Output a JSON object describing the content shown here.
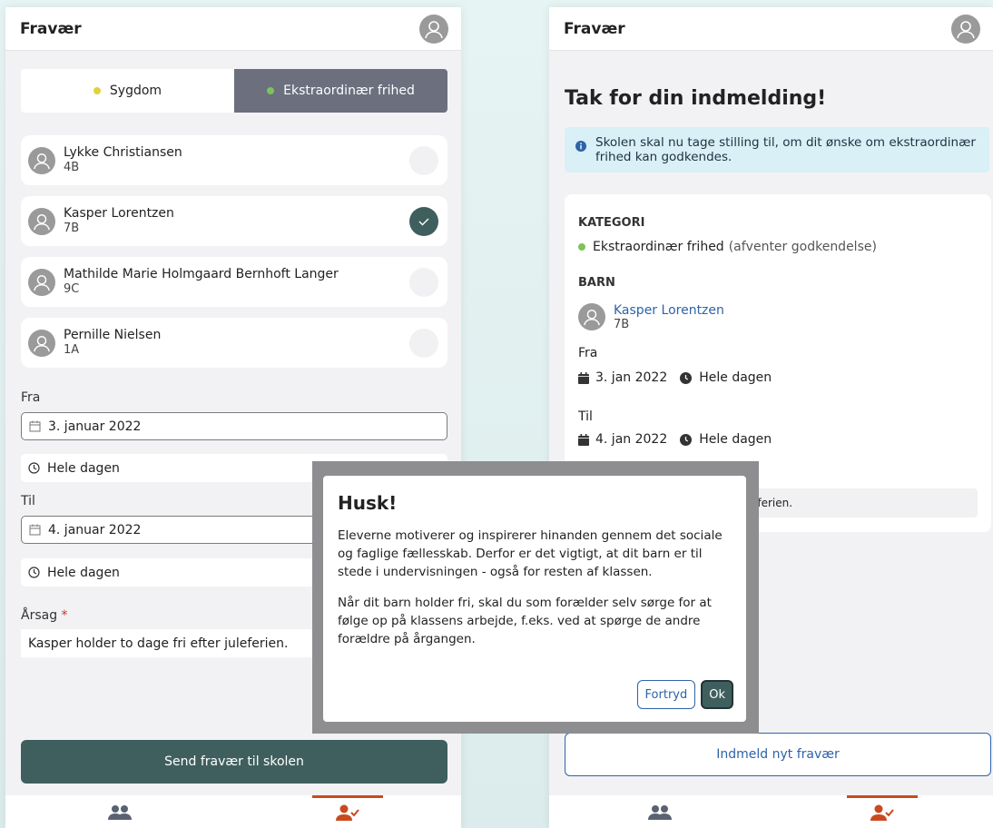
{
  "app_title": "Fravær",
  "left": {
    "tabs": [
      {
        "label": "Sygdom",
        "dot_color": "#e2d23a",
        "active": false
      },
      {
        "label": "Ekstraordinær frihed",
        "dot_color": "#7cc35a",
        "active": true
      }
    ],
    "children": [
      {
        "name": "Lykke Christiansen",
        "class": "4B",
        "selected": false
      },
      {
        "name": "Kasper Lorentzen",
        "class": "7B",
        "selected": true
      },
      {
        "name": "Mathilde Marie Holmgaard Bernhoft Langer",
        "class": "9C",
        "selected": false
      },
      {
        "name": "Pernille Nielsen",
        "class": "1A",
        "selected": false
      }
    ],
    "from_label": "Fra",
    "from_date": "3. januar 2022",
    "from_time": "Hele dagen",
    "to_label": "Til",
    "to_date": "4. januar 2022",
    "to_time": "Hele dagen",
    "reason_label": "Årsag",
    "required_mark": "*",
    "reason_value": "Kasper holder to dage fri efter juleferien.",
    "submit_label": "Send fravær til skolen"
  },
  "right": {
    "heading": "Tak for din indmelding!",
    "info": "Skolen skal nu tage stilling til, om dit ønske om ekstraordinær frihed kan godkendes.",
    "category_heading": "KATEGORI",
    "category_value": "Ekstraordinær frihed",
    "category_status": "(afventer godkendelse)",
    "child_heading": "BARN",
    "child_name": "Kasper Lorentzen",
    "child_class": "7B",
    "from_label": "Fra",
    "from_date": "3. jan 2022",
    "from_time": "Hele dagen",
    "to_label": "Til",
    "to_date": "4. jan 2022",
    "to_time": "Hele dagen",
    "reason_partial": "eferien.",
    "new_button": "Indmeld nyt fravær"
  },
  "modal": {
    "title": "Husk!",
    "paragraph1": "Eleverne motiverer og inspirerer hinanden gennem det sociale og faglige fællesskab. Derfor er det vigtigt, at dit barn er til stede i undervisningen - også for resten af klassen.",
    "paragraph2": "Når dit barn holder fri, skal du som forælder selv sørge for at følge op på klassens arbejde, f.eks. ved at spørge de andre forældre på årgangen.",
    "cancel_label": "Fortryd",
    "ok_label": "Ok"
  },
  "colors": {
    "primary": "#3e5f5e",
    "accent": "#c94a1f",
    "link": "#2e63a8"
  }
}
